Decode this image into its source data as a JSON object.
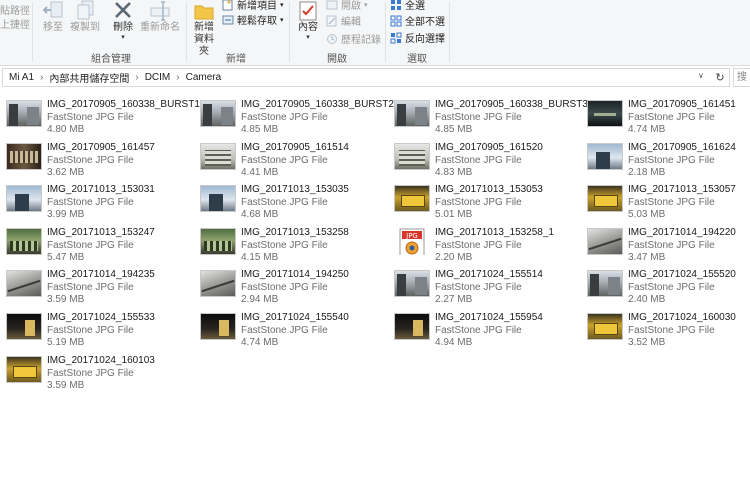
{
  "ribbon": {
    "clipboard_partial": [
      {
        "label": "貼路徑",
        "icon": "copy-path-icon"
      },
      {
        "label": "上捷徑",
        "icon": "paste-shortcut-icon"
      }
    ],
    "organize": {
      "group_label": "組合管理",
      "buttons": [
        {
          "label": "移至",
          "icon": "move-to-icon",
          "enabled": false
        },
        {
          "label": "複製到",
          "icon": "copy-to-icon",
          "enabled": false
        },
        {
          "label": "刪除",
          "icon": "delete-icon",
          "enabled": true
        },
        {
          "label": "重新命名",
          "icon": "rename-icon",
          "enabled": false
        }
      ]
    },
    "new": {
      "group_label": "新增",
      "new_folder_line1": "新增",
      "new_folder_line2": "資料夾",
      "new_item": "新增項目",
      "easy_access": "輕鬆存取"
    },
    "open": {
      "group_label": "開啟",
      "properties": "內容",
      "open": "開啟",
      "edit": "編輯",
      "history": "歷程記錄"
    },
    "select": {
      "group_label": "選取",
      "select_all": "全選",
      "select_none": "全部不選",
      "invert": "反向選擇"
    }
  },
  "address": {
    "crumbs": [
      "Mi A1",
      "內部共用儲存空間",
      "DCIM",
      "Camera"
    ],
    "search_placeholder": "搜"
  },
  "files": [
    {
      "name": "IMG_20170905_160338_BURST1",
      "type": "FastStone JPG File",
      "size": "4.80 MB",
      "thumb": "street"
    },
    {
      "name": "IMG_20170905_160338_BURST2",
      "type": "FastStone JPG File",
      "size": "4.85 MB",
      "thumb": "street"
    },
    {
      "name": "IMG_20170905_160338_BURST3",
      "type": "FastStone JPG File",
      "size": "4.85 MB",
      "thumb": "street"
    },
    {
      "name": "IMG_20170905_161451",
      "type": "FastStone JPG File",
      "size": "4.74 MB",
      "thumb": "dark"
    },
    {
      "name": "IMG_20170905_161457",
      "type": "FastStone JPG File",
      "size": "3.62 MB",
      "thumb": "shop"
    },
    {
      "name": "IMG_20170905_161514",
      "type": "FastStone JPG File",
      "size": "4.41 MB",
      "thumb": "build"
    },
    {
      "name": "IMG_20170905_161520",
      "type": "FastStone JPG File",
      "size": "4.83 MB",
      "thumb": "build"
    },
    {
      "name": "IMG_20170905_161624",
      "type": "FastStone JPG File",
      "size": "2.18 MB",
      "thumb": "sky"
    },
    {
      "name": "IMG_20171013_153031",
      "type": "FastStone JPG File",
      "size": "3.99 MB",
      "thumb": "sky"
    },
    {
      "name": "IMG_20171013_153035",
      "type": "FastStone JPG File",
      "size": "4.68 MB",
      "thumb": "sky"
    },
    {
      "name": "IMG_20171013_153053",
      "type": "FastStone JPG File",
      "size": "5.01 MB",
      "thumb": "yellow"
    },
    {
      "name": "IMG_20171013_153057",
      "type": "FastStone JPG File",
      "size": "5.03 MB",
      "thumb": "yellow"
    },
    {
      "name": "IMG_20171013_153247",
      "type": "FastStone JPG File",
      "size": "5.47 MB",
      "thumb": "green"
    },
    {
      "name": "IMG_20171013_153258",
      "type": "FastStone JPG File",
      "size": "4.15 MB",
      "thumb": "green"
    },
    {
      "name": "IMG_20171013_153258_1",
      "type": "FastStone JPG File",
      "size": "2.20 MB",
      "thumb": "jpg-icon"
    },
    {
      "name": "IMG_20171014_194220",
      "type": "FastStone JPG File",
      "size": "3.47 MB",
      "thumb": "grey"
    },
    {
      "name": "IMG_20171014_194235",
      "type": "FastStone JPG File",
      "size": "3.59 MB",
      "thumb": "grey"
    },
    {
      "name": "IMG_20171014_194250",
      "type": "FastStone JPG File",
      "size": "2.94 MB",
      "thumb": "grey"
    },
    {
      "name": "IMG_20171024_155514",
      "type": "FastStone JPG File",
      "size": "2.27 MB",
      "thumb": "street"
    },
    {
      "name": "IMG_20171024_155520",
      "type": "FastStone JPG File",
      "size": "2.40 MB",
      "thumb": "street"
    },
    {
      "name": "IMG_20171024_155533",
      "type": "FastStone JPG File",
      "size": "5.19 MB",
      "thumb": "night"
    },
    {
      "name": "IMG_20171024_155540",
      "type": "FastStone JPG File",
      "size": "4.74 MB",
      "thumb": "night"
    },
    {
      "name": "IMG_20171024_155954",
      "type": "FastStone JPG File",
      "size": "4.94 MB",
      "thumb": "night"
    },
    {
      "name": "IMG_20171024_160030",
      "type": "FastStone JPG File",
      "size": "3.52 MB",
      "thumb": "yellow"
    },
    {
      "name": "IMG_20171024_160103",
      "type": "FastStone JPG File",
      "size": "3.59 MB",
      "thumb": "yellow"
    }
  ]
}
